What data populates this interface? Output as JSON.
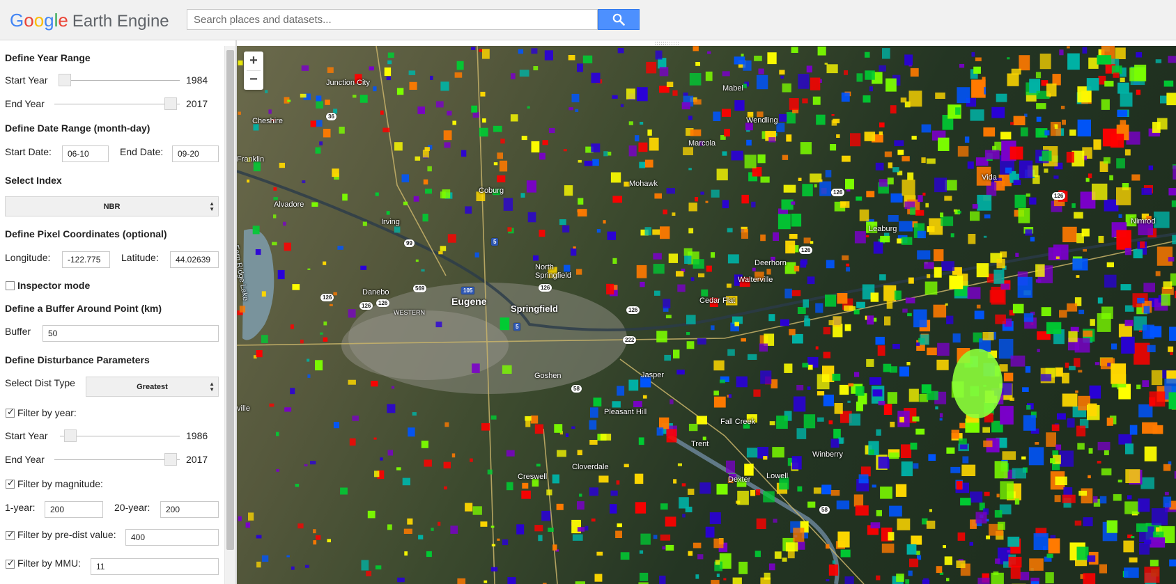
{
  "header": {
    "logo_google": [
      "G",
      "o",
      "o",
      "g",
      "l",
      "e"
    ],
    "logo_product": "Earth Engine",
    "search_placeholder": "Search places and datasets..."
  },
  "panel": {
    "year_range": {
      "heading": "Define Year Range",
      "start_label": "Start Year",
      "start_value": "1984",
      "end_label": "End Year",
      "end_value": "2017"
    },
    "date_range": {
      "heading": "Define Date Range (month-day)",
      "start_label": "Start Date:",
      "start_value": "06-10",
      "end_label": "End Date:",
      "end_value": "09-20"
    },
    "index": {
      "heading": "Select Index",
      "selected": "NBR"
    },
    "coords": {
      "heading": "Define Pixel Coordinates (optional)",
      "lon_label": "Longitude:",
      "lon_value": "-122.775",
      "lat_label": "Latitude:",
      "lat_value": "44.02639"
    },
    "inspector": {
      "label": "Inspector mode",
      "checked": false
    },
    "buffer": {
      "heading": "Define a Buffer Around Point (km)",
      "label": "Buffer",
      "value": "50"
    },
    "disturbance": {
      "heading": "Define Disturbance Parameters",
      "type_label": "Select Dist Type",
      "type_selected": "Greatest",
      "filter_year_label": "Filter by year:",
      "filter_start_label": "Start Year",
      "filter_start_value": "1986",
      "filter_end_label": "End Year",
      "filter_end_value": "2017",
      "filter_mag_label": "Filter by magnitude:",
      "one_year_label": "1-year:",
      "one_year_value": "200",
      "twenty_year_label": "20-year:",
      "twenty_year_value": "200",
      "filter_predist_label": "Filter by pre-dist value:",
      "predist_value": "400",
      "filter_mmu_label": "Filter by MMU:",
      "mmu_value": "11"
    }
  },
  "map": {
    "zoom_in": "+",
    "zoom_out": "−",
    "places": [
      {
        "name": "Junction City"
      },
      {
        "name": "Cheshire"
      },
      {
        "name": "Franklin"
      },
      {
        "name": "Alvadore"
      },
      {
        "name": "Coburg"
      },
      {
        "name": "Irving"
      },
      {
        "name": "Mohawk"
      },
      {
        "name": "Marcola"
      },
      {
        "name": "Wendling"
      },
      {
        "name": "Mabel"
      },
      {
        "name": "Vida"
      },
      {
        "name": "Leaburg"
      },
      {
        "name": "Nimrod"
      },
      {
        "name": "Deerhorn"
      },
      {
        "name": "Walterville"
      },
      {
        "name": "North Springfield"
      },
      {
        "name": "Danebo"
      },
      {
        "name": "Eugene"
      },
      {
        "name": "Springfield"
      },
      {
        "name": "WESTERN"
      },
      {
        "name": "Cedar Flat"
      },
      {
        "name": "Goshen"
      },
      {
        "name": "Jasper"
      },
      {
        "name": "Pleasant Hill"
      },
      {
        "name": "Fall Creek"
      },
      {
        "name": "Trent"
      },
      {
        "name": "Winberry"
      },
      {
        "name": "Cloverdale"
      },
      {
        "name": "Creswell"
      },
      {
        "name": "Dexter"
      },
      {
        "name": "Lowell"
      },
      {
        "name": "Fern Ridge Lake"
      },
      {
        "name": "ville"
      }
    ],
    "shields": [
      "36",
      "99",
      "569",
      "5",
      "105",
      "126",
      "126",
      "126",
      "126",
      "569",
      "99",
      "126",
      "126",
      "5",
      "222",
      "58",
      "58",
      "126",
      "126"
    ]
  }
}
